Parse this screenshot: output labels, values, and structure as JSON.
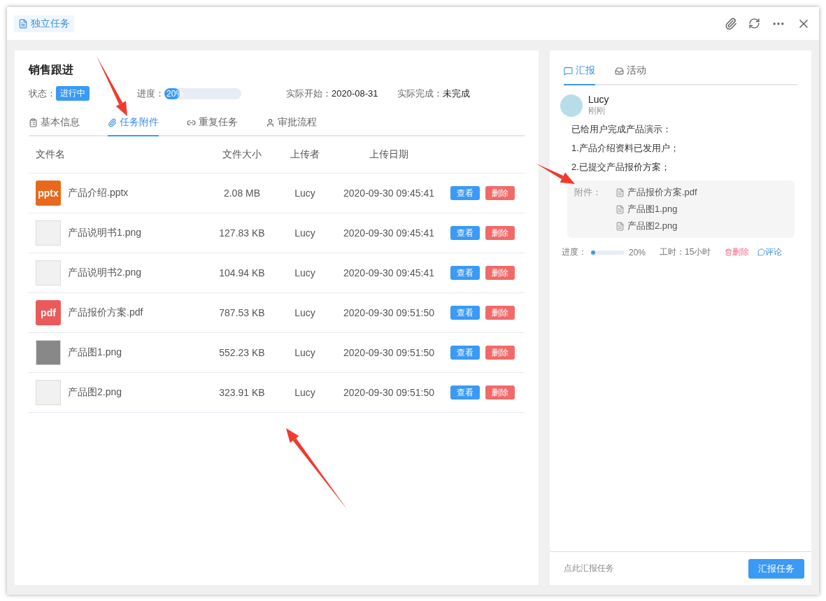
{
  "window": {
    "title": "独立任务"
  },
  "task": {
    "title": "销售跟进",
    "status_label": "状态：",
    "status": "进行中",
    "progress_label": "进度：",
    "progress": {
      "level": 0.2,
      "reading": "20%"
    },
    "start_label": "实际开始：",
    "start": "2020-08-31",
    "finish_label": "实际完成：",
    "finish": "未完成"
  },
  "tabs": [
    {
      "label": "基本信息",
      "selected": false
    },
    {
      "label": "任务附件",
      "selected": true
    },
    {
      "label": "重复任务",
      "selected": false
    },
    {
      "label": "审批流程",
      "selected": false
    }
  ],
  "table": {
    "columns": [
      "文件名",
      "文件大小",
      "上传者",
      "上传日期"
    ],
    "rows": [
      {
        "kind": "badge",
        "badge": "pptx",
        "color": "#e8691b",
        "name": "产品介绍.pptx",
        "size": "2.08 MB",
        "uploader": "Lucy",
        "date": "2020-09-30 09:45:41",
        "actions": [
          "查看",
          "删除"
        ]
      },
      {
        "kind": "thumb",
        "name": "产品说明书1.png",
        "size": "127.83 KB",
        "uploader": "Lucy",
        "date": "2020-09-30 09:45:41",
        "actions": [
          "查看",
          "删除"
        ]
      },
      {
        "kind": "thumb",
        "name": "产品说明书2.png",
        "size": "104.94 KB",
        "uploader": "Lucy",
        "date": "2020-09-30 09:45:41",
        "actions": [
          "查看",
          "删除"
        ]
      },
      {
        "kind": "badge",
        "badge": "pdf",
        "color": "#eb5a5a",
        "name": "产品报价方案.pdf",
        "size": "787.53 KB",
        "uploader": "Lucy",
        "date": "2020-09-30 09:51:50",
        "actions": [
          "查看",
          "删除"
        ]
      },
      {
        "kind": "thumb",
        "name": "产品图1.png",
        "size": "552.23 KB",
        "uploader": "Lucy",
        "date": "2020-09-30 09:51:50",
        "actions": [
          "查看",
          "删除"
        ]
      },
      {
        "kind": "thumb",
        "name": "产品图2.png",
        "size": "323.91 KB",
        "uploader": "Lucy",
        "date": "2020-09-30 09:51:50",
        "actions": [
          "查看",
          "删除"
        ]
      }
    ]
  },
  "side_tabs": [
    {
      "label": "汇报",
      "selected": true
    },
    {
      "label": "活动",
      "selected": false
    }
  ],
  "report": {
    "author": "Lucy",
    "time": "刚刚",
    "lines": [
      "已给用户完成产品演示：",
      "1.产品介绍资料已发用户；",
      "2.已提交产品报价方案；"
    ],
    "attachments_label": "附件：",
    "attachments": [
      "产品报价方案.pdf",
      "产品图1.png",
      "产品图2.png"
    ],
    "progress_label": "进度：",
    "progress": {
      "level": 0.06,
      "reading": "20%"
    },
    "hours": "工时：15小时",
    "delete": "删除",
    "comment": "评论"
  },
  "footer": {
    "hint": "点此汇报任务",
    "button": "汇报任务"
  }
}
